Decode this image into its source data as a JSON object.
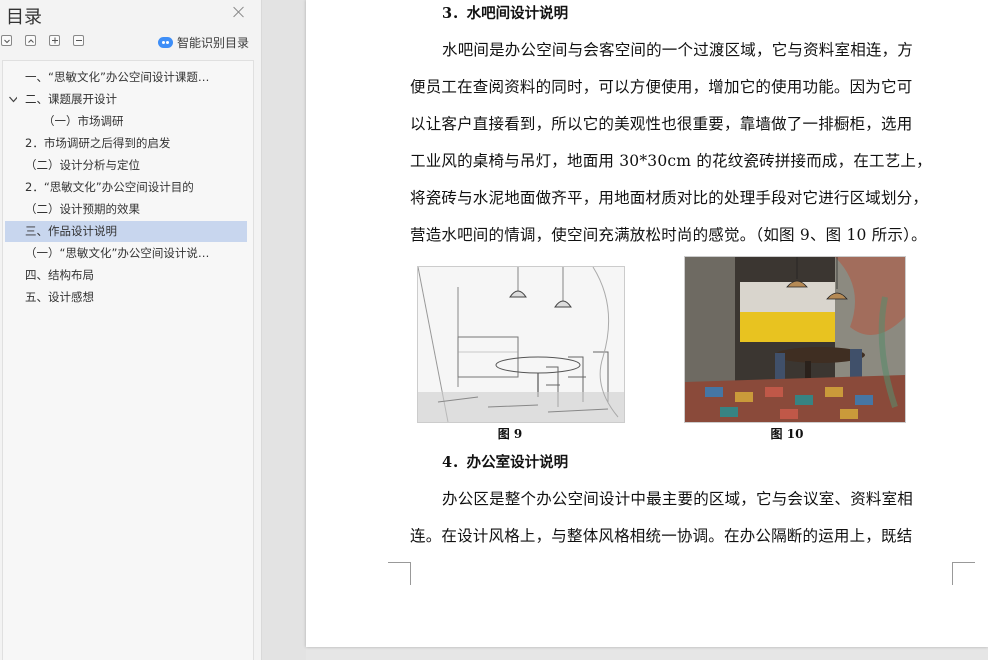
{
  "sidebar": {
    "title": "目录",
    "smart_toc_label": "智能识别目录",
    "items": [
      {
        "label": "一、“思敏文化”办公空间设计课题…",
        "level": 0,
        "expandable": false
      },
      {
        "label": "二、课题展开设计",
        "level": 0,
        "expandable": true
      },
      {
        "label": "（一）市场调研",
        "level": 1,
        "expandable": false
      },
      {
        "label": "2．市场调研之后得到的启发",
        "level": 0,
        "expandable": false
      },
      {
        "label": "（二）设计分析与定位",
        "level": 0,
        "expandable": false
      },
      {
        "label": "2．“思敏文化”办公空间设计目的",
        "level": 0,
        "expandable": false
      },
      {
        "label": "（二）设计预期的效果",
        "level": 0,
        "expandable": false
      },
      {
        "label": "三、作品设计说明",
        "level": 0,
        "expandable": false,
        "active": true
      },
      {
        "label": "（一）“思敏文化”办公空间设计说…",
        "level": 0,
        "expandable": false
      },
      {
        "label": "四、结构布局",
        "level": 0,
        "expandable": false
      },
      {
        "label": "五、设计感想",
        "level": 0,
        "expandable": false
      }
    ]
  },
  "document": {
    "heading1": "3．水吧间设计说明",
    "para1": [
      "水吧间是办公空间与会客空间的一个过渡区域，它与资料室相连，方",
      "便员工在查阅资料的同时，可以方便使用，增加它的使用功能。因为它可",
      "以让客户直接看到，所以它的美观性也很重要，靠墙做了一排橱柜，选用",
      "工业风的桌椅与吊灯，地面用 30*30cm 的花纹瓷砖拼接而成，在工艺上，",
      "将瓷砖与水泥地面做齐平，用地面材质对比的处理手段对它进行区域划分，",
      "营造水吧间的情调，使空间充满放松时尚的感觉。（如图 9、图 10 所示）。"
    ],
    "figure9_caption": "图 9",
    "figure10_caption": "图 10",
    "heading2": "4．办公室设计说明",
    "para2": [
      "办公区是整个办公空间设计中最主要的区域，它与会议室、资料室相",
      "连。在设计风格上，与整体风格相统一协调。在办公隔断的运用上，既结"
    ]
  },
  "colors": {
    "active_toc_bg": "#c8d6ee",
    "smart_icon": "#3e8ef7",
    "render_yellow": "#e8c320"
  }
}
